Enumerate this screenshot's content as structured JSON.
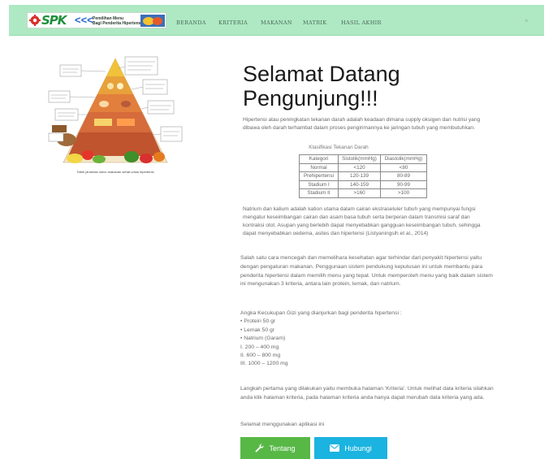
{
  "navbar": {
    "logo": {
      "brand": "SPK",
      "chevrons": "<<<",
      "tagline_1": "Pemilihan Menu",
      "tagline_2": "Bagi Penderita Hipertensi"
    },
    "items": [
      {
        "label": "BERANDA"
      },
      {
        "label": "KRITERIA"
      },
      {
        "label": "MAKANAN"
      },
      {
        "label": "MATRIK"
      },
      {
        "label": "HASIL AKHIR"
      }
    ],
    "right_label": "≡"
  },
  "pyramid": {
    "caption": "Tabel piramida menu makanan sehat untuk hipertensi"
  },
  "main": {
    "title": "Selamat Datang Pengunjung!!!",
    "intro": "Hipertensi atau peningkatan tekanan darah adalah keadaan dimana supply oksigen dan nutrisi yang dibawa oleh darah terhambat dalam proses pengirimannya ke jaringan tubuh yang membutuhkan.",
    "table": {
      "caption": "Klasifikasi Tekanan Darah",
      "headers": [
        "Kategori",
        "Sistolik(mmHg)",
        "Diastolik(mmHg)"
      ],
      "rows": [
        [
          "Normal",
          "<120",
          "<80"
        ],
        [
          "Prehipertensi",
          "120-139",
          "80-89"
        ],
        [
          "Stadium I",
          "140-159",
          "90-99"
        ],
        [
          "Stadium II",
          ">160",
          ">100"
        ]
      ]
    },
    "natrium": "Natrium dan kalium adalah kation utama dalam cairan ekstraseluler tubuh yang mempunyai fungsi mengatur keseimbangan cairan dan asam basa tubuh serta berperan dalam transmisi saraf dan kontraksi otot. Asupan yang berlebih dapat menyebabkan gangguan keseimbangan tubuh, sehingga dapat menyebabkan oedema, asites dan hipertensi (Listyaningsih et al., 2014)",
    "prevent": "Salah satu cara mencegah dan memelihara kesehatan agar terhindar dari penyakit hipertensi yaitu dengan pengaturan makanan. Penggunaan sistem pendukung keputusan ini untuk membantu para penderita hipertensi dalam memilih menu yang tepat. Untuk memperoleh menu yang baik dalam sistem ini mengunakan 3 kriteria, antara lain protein, lemak, dan natrium.",
    "akg": {
      "heading": "Angka Kecukupan Gizi yang dianjurkan bagi penderita hipertensi :",
      "lines": [
        "• Protein 50 gr",
        "• Lemak 50 gr",
        "• Natrium (Garam)",
        "I. 200 – 400 mg",
        "II. 600 – 800 mg",
        "III. 1000 – 1200 mg"
      ]
    },
    "steps": "Langkah pertama yang dilakukan yaitu membuka halaman 'Kriteria'. Untuk melihat data kriteria silahkan anda klik halaman kriteria, pada halaman kriteria anda hanya dapat merubah data kriteria yang ada.",
    "closing": "Selamat menggunakan aplikasi ini"
  },
  "buttons": {
    "tentang": "Tentang",
    "hubungi": "Hubungi"
  },
  "colors": {
    "navbar_bg": "#aee9c3",
    "tentang_bg": "#57b846",
    "hubungi_bg": "#1bb3e0"
  }
}
